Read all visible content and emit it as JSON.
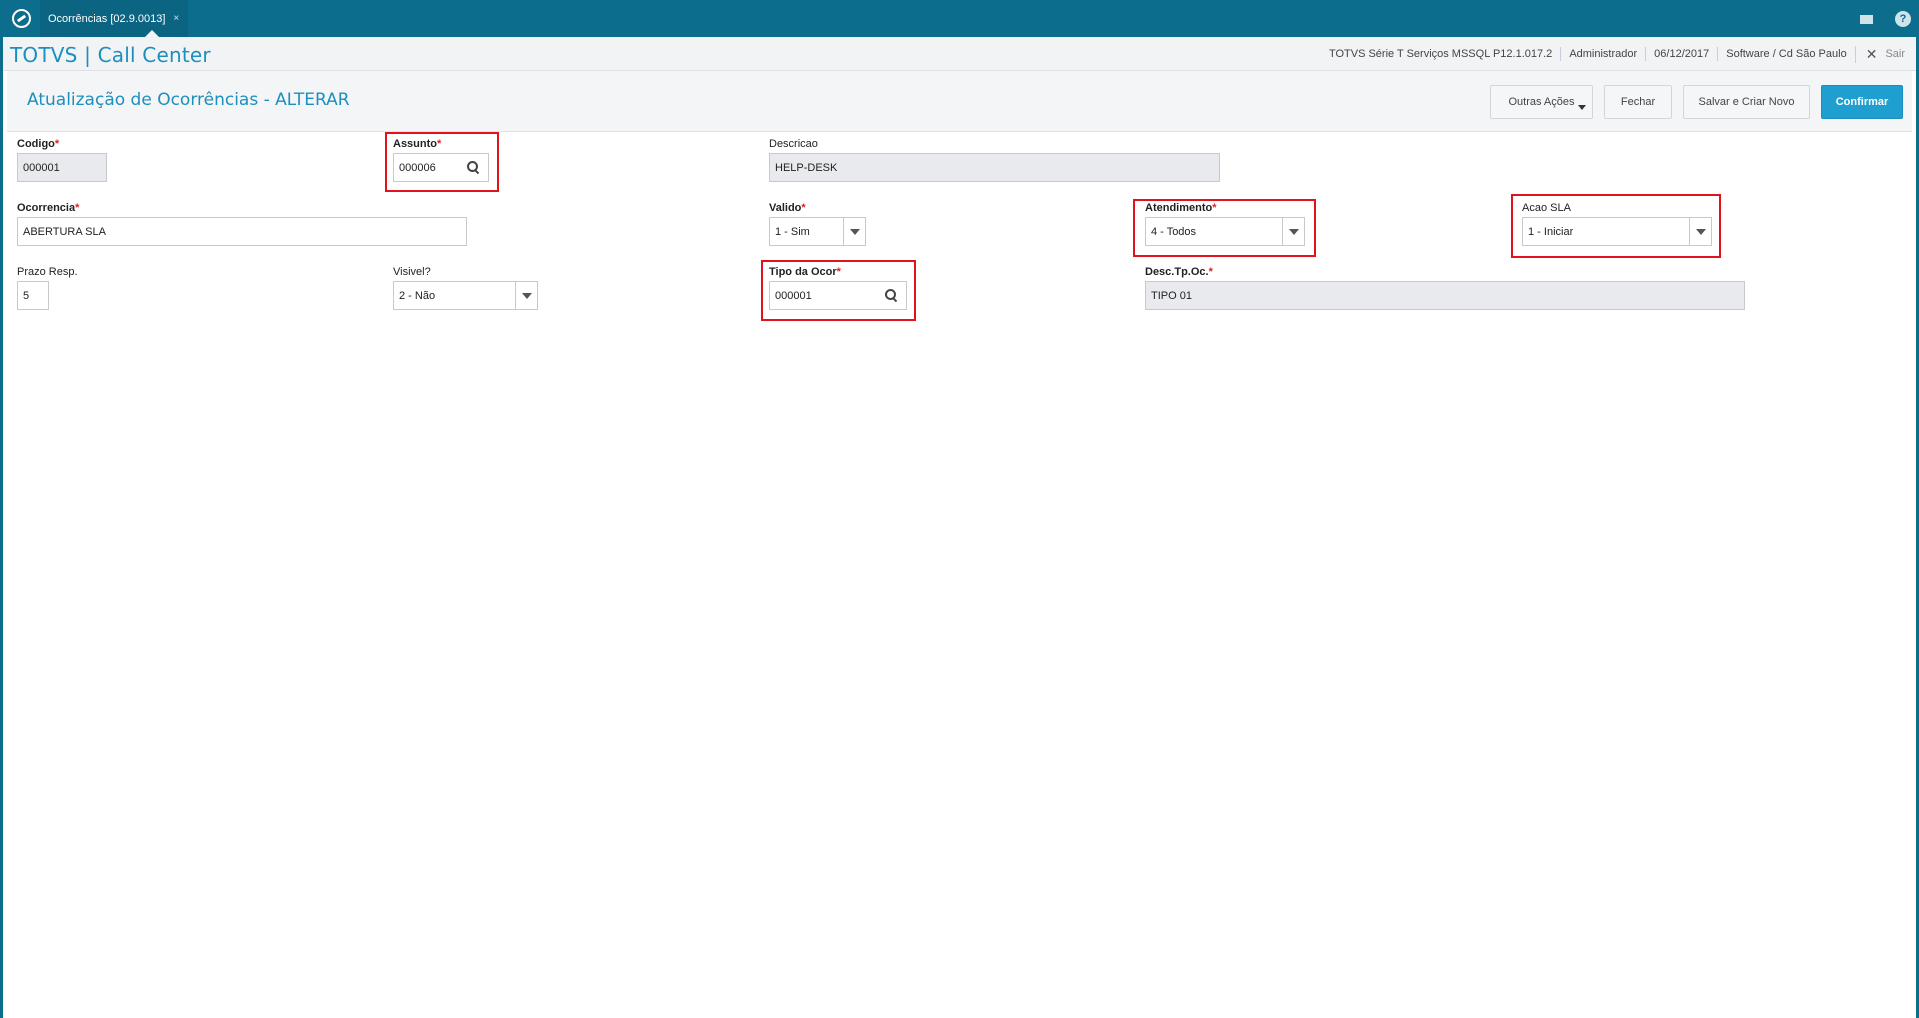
{
  "tab": {
    "title": "Ocorrências [02.9.0013]",
    "close": "×"
  },
  "topbar_icons": [
    "mail-icon",
    "help-icon"
  ],
  "help_glyph": "?",
  "brand": "TOTVS | Call Center",
  "header_info": {
    "system": "TOTVS Série T Serviços MSSQL P12.1.017.2",
    "user": "Administrador",
    "date": "06/12/2017",
    "company": "Software / Cd São Paulo",
    "logout": "Sair",
    "logout_glyph": "✕"
  },
  "page": {
    "title": "Atualização de Ocorrências - ALTERAR"
  },
  "actions": {
    "outras": "Outras Ações",
    "fechar": "Fechar",
    "salvar": "Salvar e Criar Novo",
    "confirmar": "Confirmar"
  },
  "form": {
    "codigo": {
      "label": "Codigo",
      "value": "000001"
    },
    "assunto": {
      "label": "Assunto",
      "value": "000006"
    },
    "descricao": {
      "label": "Descricao",
      "value": "HELP-DESK"
    },
    "ocorrencia": {
      "label": "Ocorrencia",
      "value": "ABERTURA SLA"
    },
    "valido": {
      "label": "Valido",
      "value": "1 - Sim"
    },
    "atendimento": {
      "label": "Atendimento",
      "value": "4 - Todos"
    },
    "acao_sla": {
      "label": "Acao SLA",
      "value": "1 - Iniciar"
    },
    "prazo": {
      "label": "Prazo Resp.",
      "value": "5"
    },
    "visivel": {
      "label": "Visivel?",
      "value": "2 - Não"
    },
    "tipo_ocor": {
      "label": "Tipo da Ocor",
      "value": "000001"
    },
    "desc_tp": {
      "label": "Desc.Tp.Oc.",
      "value": "TIPO 01"
    },
    "required_mark": "*"
  },
  "colors": {
    "topbar": "#0c6e8c",
    "brand": "#1d8fbf",
    "confirm": "#1e9fd0",
    "required": "#e02020",
    "highlight": "#e0121c"
  }
}
